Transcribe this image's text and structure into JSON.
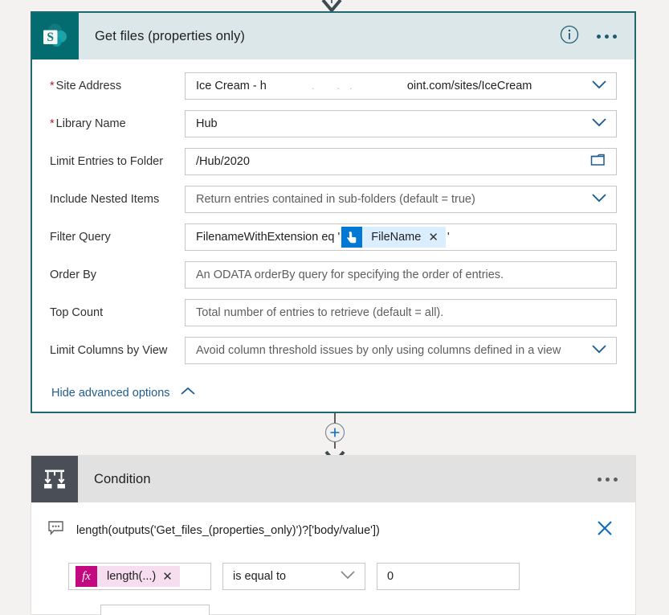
{
  "flow": {
    "top_connector_icon": "arrow-down-icon",
    "between_connector": {
      "add_icon": "plus-circle-icon",
      "arrow_icon": "arrow-down-icon"
    }
  },
  "get_files_card": {
    "app_icon": "sharepoint-icon",
    "title": "Get files (properties only)",
    "info_icon": "info-icon",
    "menu_icon": "ellipsis-icon",
    "fields": [
      {
        "label": "Site Address",
        "required": true,
        "value_prefix": "Ice Cream - h",
        "value_redacted": ". ..",
        "value_suffix": "oint.com/sites/IceCream",
        "control": "dropdown",
        "icon": "chevron-down-icon"
      },
      {
        "label": "Library Name",
        "required": true,
        "value": "Hub",
        "control": "dropdown",
        "icon": "chevron-down-icon"
      },
      {
        "label": "Limit Entries to Folder",
        "required": false,
        "value": "/Hub/2020",
        "control": "folder-picker",
        "icon": "folder-icon"
      },
      {
        "label": "Include Nested Items",
        "required": false,
        "placeholder": "Return entries contained in sub-folders (default = true)",
        "control": "dropdown",
        "icon": "chevron-down-icon"
      },
      {
        "label": "Filter Query",
        "required": false,
        "control": "token-input",
        "text_before": "FilenameWithExtension eq '",
        "token": {
          "icon": "manual-trigger-hand-icon",
          "label": "FileName",
          "remove_icon": "close-icon"
        },
        "text_after": "'"
      },
      {
        "label": "Order By",
        "required": false,
        "placeholder": "An ODATA orderBy query for specifying the order of entries.",
        "control": "text"
      },
      {
        "label": "Top Count",
        "required": false,
        "placeholder": "Total number of entries to retrieve (default = all).",
        "control": "text"
      },
      {
        "label": "Limit Columns by View",
        "required": false,
        "placeholder": "Avoid column threshold issues by only using columns defined in a view",
        "control": "dropdown",
        "icon": "chevron-down-icon"
      }
    ],
    "advanced_options_label": "Hide advanced options",
    "advanced_options_icon": "chevron-up-icon"
  },
  "condition_card": {
    "app_icon": "condition-branch-icon",
    "title": "Condition",
    "menu_icon": "ellipsis-icon",
    "comment": {
      "icon": "comment-icon",
      "text": "length(outputs('Get_files_(properties_only)')?['body/value'])",
      "close_icon": "close-icon"
    },
    "condition_row": {
      "left_token": {
        "icon": "fx-icon",
        "label": "length(...)",
        "remove_icon": "close-icon"
      },
      "operator": "is equal to",
      "operator_icon": "chevron-down-icon",
      "right_value": "0"
    }
  },
  "colors": {
    "selected_border": "#1e6a6e",
    "sharepoint_teal": "#036c70",
    "header_blue": "#dbe7e9",
    "condition_header_grey": "#e1e1e1",
    "condition_icon_grey": "#4a4e57",
    "token_blue": "#0078d4",
    "token_blue_bg": "#dbeeff",
    "fx_magenta": "#c2097f",
    "fx_pink_bg": "#f6ddf0",
    "link_blue": "#1f5c8f",
    "required_red": "#a4262c",
    "canvas_grey": "#f3f2f1"
  }
}
